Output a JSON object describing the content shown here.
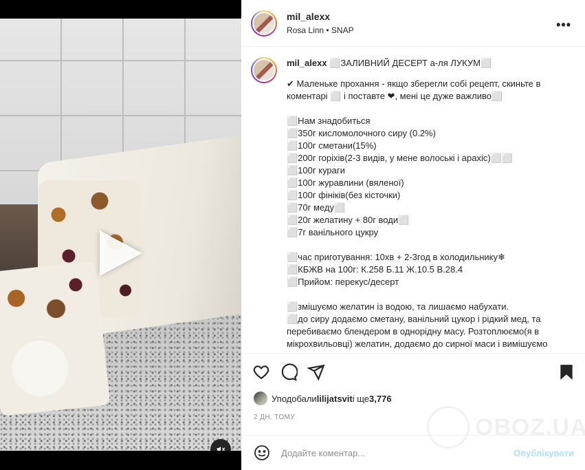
{
  "post": {
    "username": "mil_alexx",
    "audio": "Rosa Linn • SNAP",
    "caption_title": "⬜ЗАЛИВНИЙ ДЕСЕРТ а-ля ЛУКУМ⬜",
    "caption_lines": [
      "✔ Маленьке прохання - якщо зберегли собі рецепт, скиньте в коментарі ⬜ і поставте ❤, мені це дуже важливо⬜",
      "",
      "⬜Нам знадобиться",
      "⬜350г кисломолочного сиру (0.2%)",
      "⬜100г сметани(15%)",
      "⬜200г горіхів(2-3 видів, у мене волоські і арахіс)⬜⬜",
      "⬜100г кураги",
      "⬜100г журавлини (вяленої)",
      "⬜100г фініків(без кісточки)",
      "⬜70г меду⬜",
      "⬜20г желатину + 80г води⬜",
      "⬜7г ванільного цукру",
      "",
      "⬜час приготування: 10хв + 2-3год в холодильнику❄",
      "⬜КБЖВ на 100г: К.258 Б.11 Ж.10.5 В.28.4",
      "⬜Прийом: перекус/десерт",
      "",
      "⬜змішуємо желатин із водою, та лишаємо набухати.",
      "⬜до сиру додаємо сметану, ванільний цукор і рідкий мед, та перебиваємо блендером в однорідну масу. Розтоплюємо(я в мікрохвильовці) желатин, додаємо до сирної маси і вимішуємо"
    ],
    "likes_prefix": "Уподобали ",
    "likes_user": "lilijatsvit",
    "likes_mid": " і ще ",
    "likes_count": "3,776",
    "time": "2 ДН. ТОМУ",
    "comment_placeholder": "Додайте коментар...",
    "publish_label": "Опублікувати",
    "watermark": "OBOZ.UA"
  },
  "icons": {
    "more": "more-horizontal-icon",
    "like": "heart-icon",
    "comment": "comment-icon",
    "share": "share-icon",
    "save": "bookmark-icon",
    "mute": "muted-speaker-icon",
    "play": "play-icon",
    "emoji": "emoji-icon"
  }
}
